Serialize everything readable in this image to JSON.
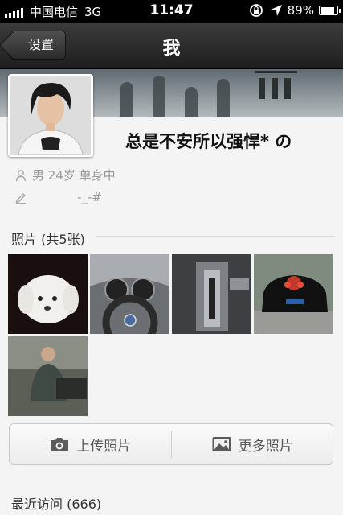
{
  "status_bar": {
    "carrier": "中国电信",
    "network": "3G",
    "time": "11:47",
    "battery": "89%",
    "battery_level": 0.89
  },
  "nav": {
    "back_label": "设置",
    "title": "我"
  },
  "profile": {
    "nickname": "总是不安所以强悍* の",
    "details": "男 24岁 单身中",
    "signature": "-_-#"
  },
  "photos": {
    "header": "照片 (共5张)",
    "items": [
      {
        "name": "puppy-photo"
      },
      {
        "name": "steering-wheel-photo"
      },
      {
        "name": "gear-shifter-photo"
      },
      {
        "name": "wedding-car-photo"
      },
      {
        "name": "person-photo"
      }
    ]
  },
  "actions": {
    "upload_label": "上传照片",
    "more_label": "更多照片"
  },
  "recent": {
    "label": "最近访问 (666)"
  },
  "colors": {
    "nav_bg": "#2d2d2d",
    "page_bg": "#f4f4f4"
  }
}
